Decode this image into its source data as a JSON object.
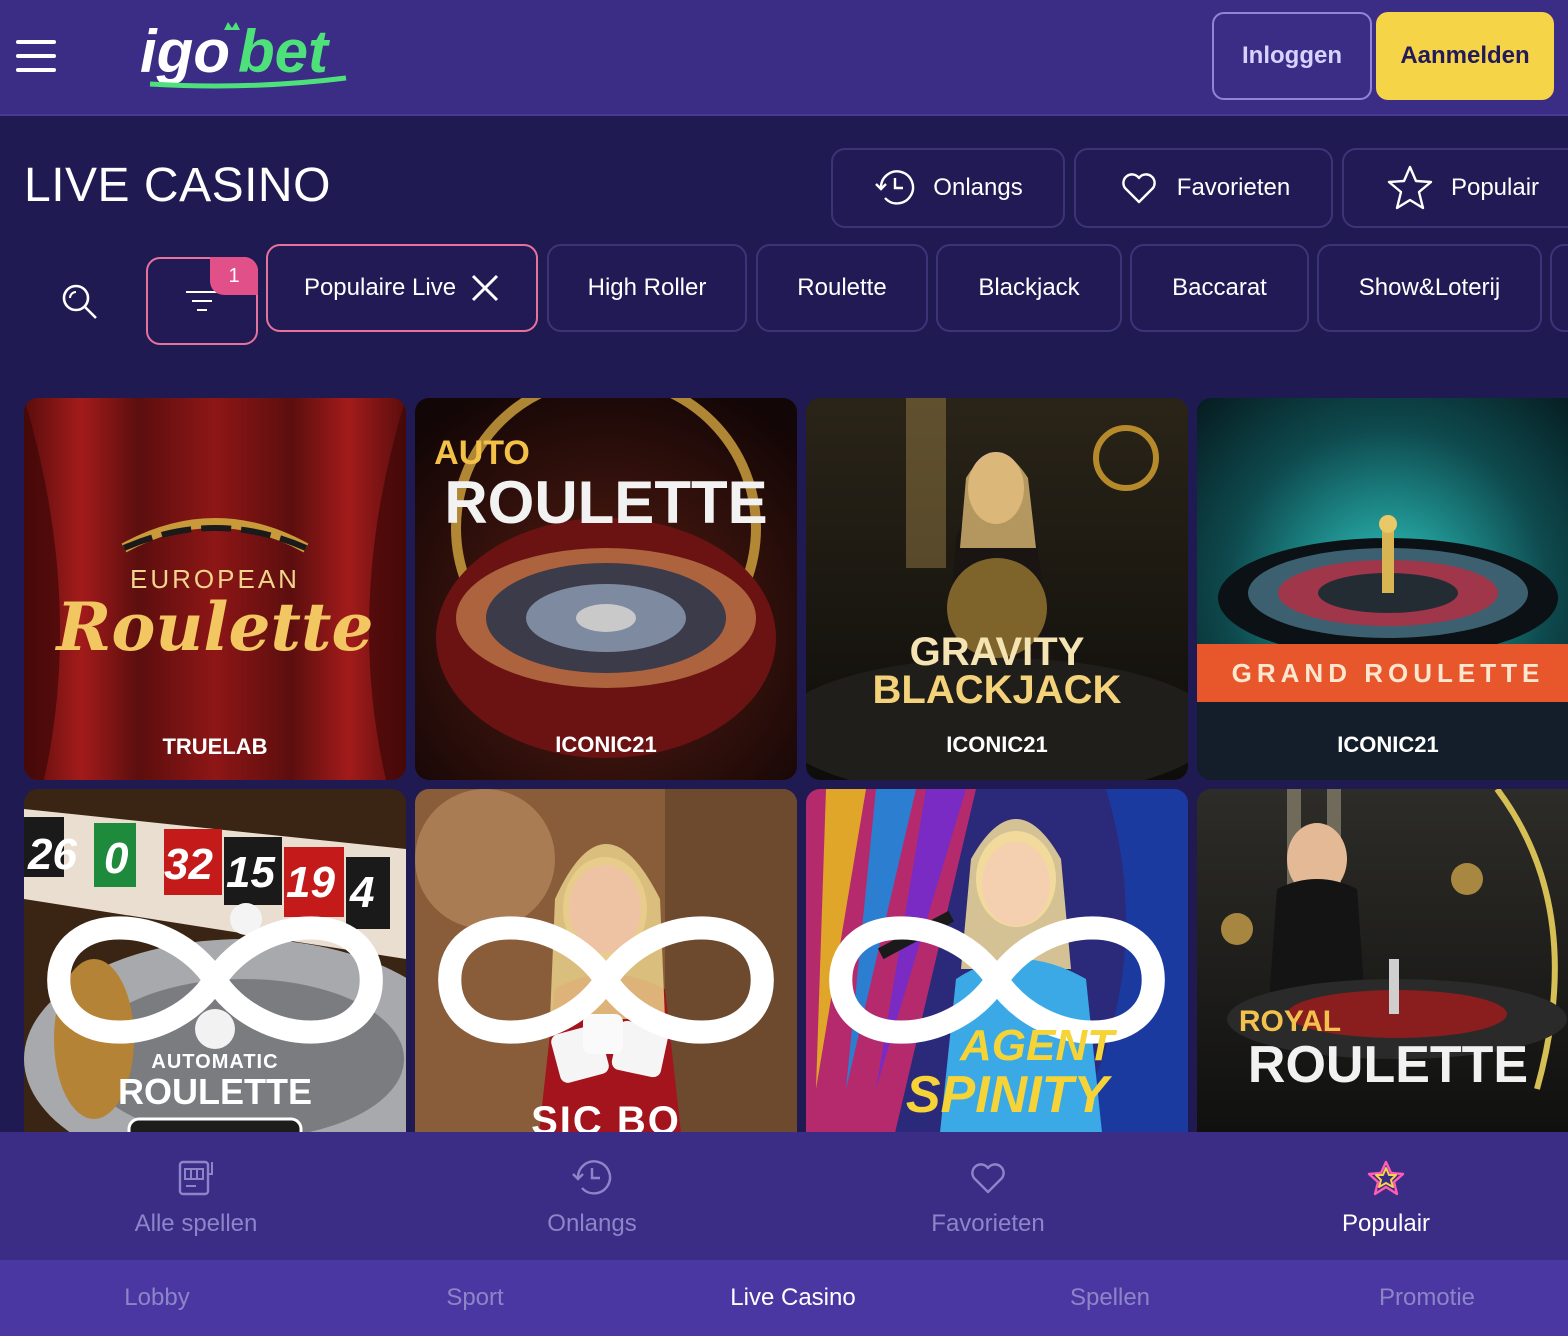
{
  "header": {
    "logo_text": "igobet",
    "login_label": "Inloggen",
    "signup_label": "Aanmelden"
  },
  "page": {
    "title": "LIVE CASINO"
  },
  "quick_filters": [
    {
      "label": "Onlangs",
      "icon": "history-icon"
    },
    {
      "label": "Favorieten",
      "icon": "heart-icon"
    },
    {
      "label": "Populair",
      "icon": "star-icon"
    }
  ],
  "filter": {
    "badge_count": "1"
  },
  "categories": [
    {
      "label": "Populaire Live",
      "active": true
    },
    {
      "label": "High Roller"
    },
    {
      "label": "Roulette"
    },
    {
      "label": "Blackjack"
    },
    {
      "label": "Baccarat"
    },
    {
      "label": "Show&Loterij"
    }
  ],
  "games": [
    {
      "line1": "EUROPEAN",
      "line2": "Roulette",
      "provider": "TRUELAB"
    },
    {
      "line1": "AUTO",
      "line2": "ROULETTE",
      "provider": "ICONIC21"
    },
    {
      "line1": "GRAVITY",
      "line2": "BLACKJACK",
      "provider": "ICONIC21"
    },
    {
      "line1": "GRAND ROULETTE",
      "line2": "",
      "provider": "ICONIC21"
    },
    {
      "line1": "AUTOMATIC",
      "line2": "ROULETTE",
      "provider": ""
    },
    {
      "line1": "SIC BO",
      "line2": "",
      "provider": ""
    },
    {
      "line1": "AGENT",
      "line2": "SPINITY",
      "provider": ""
    },
    {
      "line1": "ROYAL",
      "line2": "ROULETTE",
      "provider": ""
    }
  ],
  "subnav": [
    {
      "label": "Alle spellen",
      "icon": "slot-machine-icon"
    },
    {
      "label": "Onlangs",
      "icon": "history-icon"
    },
    {
      "label": "Favorieten",
      "icon": "heart-icon"
    },
    {
      "label": "Populair",
      "icon": "star-icon",
      "active": true
    }
  ],
  "mainnav": [
    {
      "label": "Lobby"
    },
    {
      "label": "Sport"
    },
    {
      "label": "Live Casino",
      "active": true
    },
    {
      "label": "Spellen"
    },
    {
      "label": "Promotie"
    }
  ],
  "colors": {
    "background": "#201a52",
    "header": "#3b2c86",
    "accent_yellow": "#f5d547",
    "accent_pink": "#e5739c",
    "logo_green": "#4ee07a"
  }
}
